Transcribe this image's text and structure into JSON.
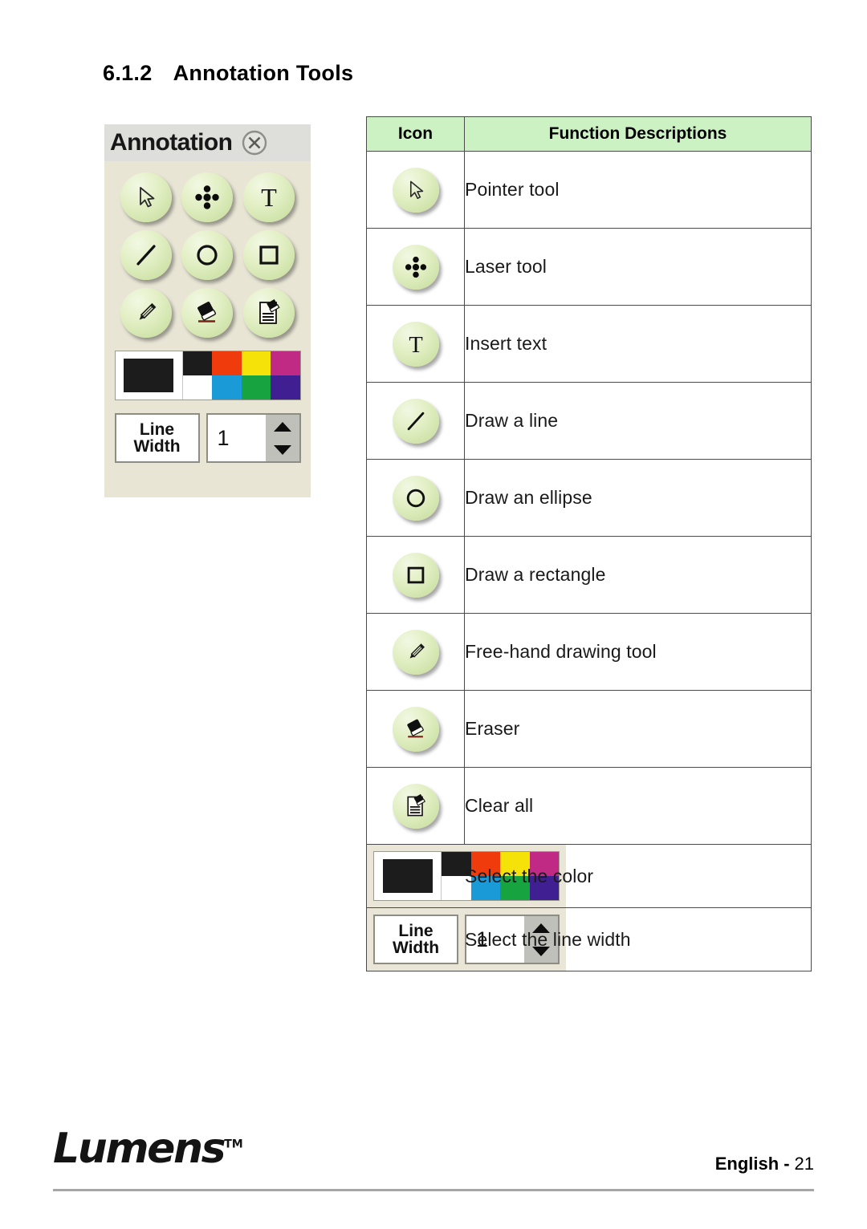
{
  "heading": {
    "number": "6.1.2",
    "title": "Annotation Tools"
  },
  "annotation_panel": {
    "title": "Annotation",
    "close_icon": "close-circle-icon",
    "buttons": [
      {
        "icon": "pointer-icon",
        "name": "pointer-tool"
      },
      {
        "icon": "laser-icon",
        "name": "laser-tool"
      },
      {
        "icon": "text-icon",
        "name": "insert-text-tool"
      },
      {
        "icon": "line-icon",
        "name": "draw-line-tool"
      },
      {
        "icon": "ellipse-icon",
        "name": "draw-ellipse-tool"
      },
      {
        "icon": "rectangle-icon",
        "name": "draw-rectangle-tool"
      },
      {
        "icon": "pencil-icon",
        "name": "free-hand-tool"
      },
      {
        "icon": "eraser-icon",
        "name": "eraser-tool"
      },
      {
        "icon": "clear-all-icon",
        "name": "clear-all-tool"
      }
    ],
    "palette": {
      "preview_color": "#1c1c1c",
      "swatches": [
        "#1c1c1c",
        "#f03c0c",
        "#f5e209",
        "#c12a84",
        "#ffffff",
        "#1a9ad7",
        "#16a340",
        "#3f1f91"
      ]
    },
    "line_width": {
      "label_line1": "Line",
      "label_line2": "Width",
      "value": "1",
      "up_icon": "triangle-up-icon",
      "down_icon": "triangle-down-icon"
    }
  },
  "table": {
    "headers": [
      "Icon",
      "Function Descriptions"
    ],
    "header_bg": "#ccf2c4",
    "rows": [
      {
        "icon": "pointer-icon",
        "description": "Pointer tool"
      },
      {
        "icon": "laser-icon",
        "description": "Laser tool"
      },
      {
        "icon": "text-icon",
        "description": "Insert text"
      },
      {
        "icon": "line-icon",
        "description": "Draw a line"
      },
      {
        "icon": "ellipse-icon",
        "description": "Draw an ellipse"
      },
      {
        "icon": "rectangle-icon",
        "description": "Draw a rectangle"
      },
      {
        "icon": "pencil-icon",
        "description": "Free-hand drawing tool"
      },
      {
        "icon": "eraser-icon",
        "description": "Eraser"
      },
      {
        "icon": "clear-all-icon",
        "description": "Clear all"
      },
      {
        "icon": "color-palette-widget",
        "description": "Select the color"
      },
      {
        "icon": "line-width-widget",
        "description": "Select the line width"
      }
    ]
  },
  "footer": {
    "logo": "Lumens",
    "trademark": "TM",
    "language": "English",
    "separator": "-",
    "page_number": "21"
  }
}
